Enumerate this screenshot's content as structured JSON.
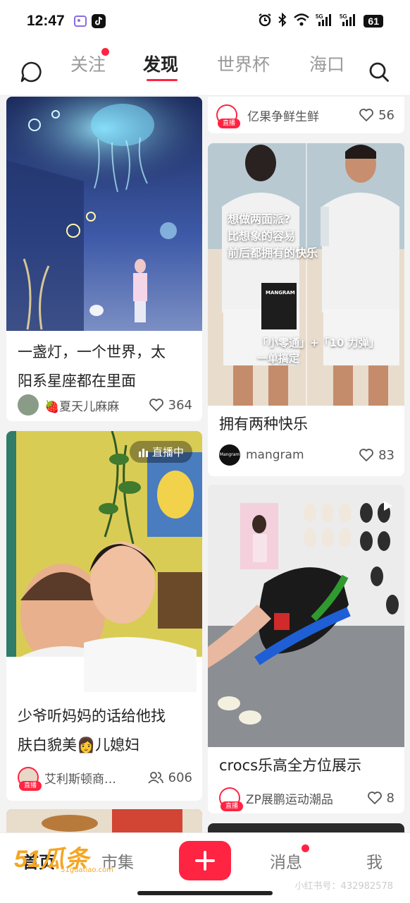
{
  "status_bar": {
    "time": "12:47",
    "battery": "61"
  },
  "top_nav": {
    "tabs": [
      {
        "label": "关注",
        "badge": true
      },
      {
        "label": "发现",
        "active": true
      },
      {
        "label": "世界杯"
      },
      {
        "label": "海口"
      }
    ]
  },
  "feed": {
    "left": [
      {
        "title_line1": "一盏灯，一个世界，太",
        "title_line2": "阳系星座都在里面",
        "author": "🍓夏天儿麻麻",
        "likes": "364"
      },
      {
        "live_badge": "直播中",
        "title_line1": "少爷听妈妈的话给他找",
        "title_line2": "肤白貌美👩儿媳妇",
        "author": "艾利斯顿商…",
        "live_tag": "直播",
        "viewers": "606"
      }
    ],
    "right": [
      {
        "author": "亿果争鲜生鲜",
        "live_tag": "直播",
        "likes": "56"
      },
      {
        "overlay_line1": "想做两面派?",
        "overlay_line2": "比想象的容易",
        "overlay_line3": "前后都拥有的快乐",
        "overlay_line4": "「小零通」+「10 力弹」",
        "overlay_line5": "一单搞定",
        "box_text": "MANGRAM",
        "title": "拥有两种快乐",
        "author": "mangram",
        "avatar_text": "Mangram",
        "likes": "83"
      },
      {
        "title": "crocs乐高全方位展示",
        "author": "ZP展鹏运动潮品",
        "live_tag": "直播",
        "likes": "8"
      }
    ]
  },
  "bottom_bar": {
    "home": "首页",
    "shop": "市集",
    "messages": "消息",
    "me": "我"
  },
  "watermark": {
    "logo": "51瓜条",
    "site": "51guatiao.com",
    "user_id": "小红书号：432982578"
  },
  "colors": {
    "accent": "#ff2442"
  }
}
